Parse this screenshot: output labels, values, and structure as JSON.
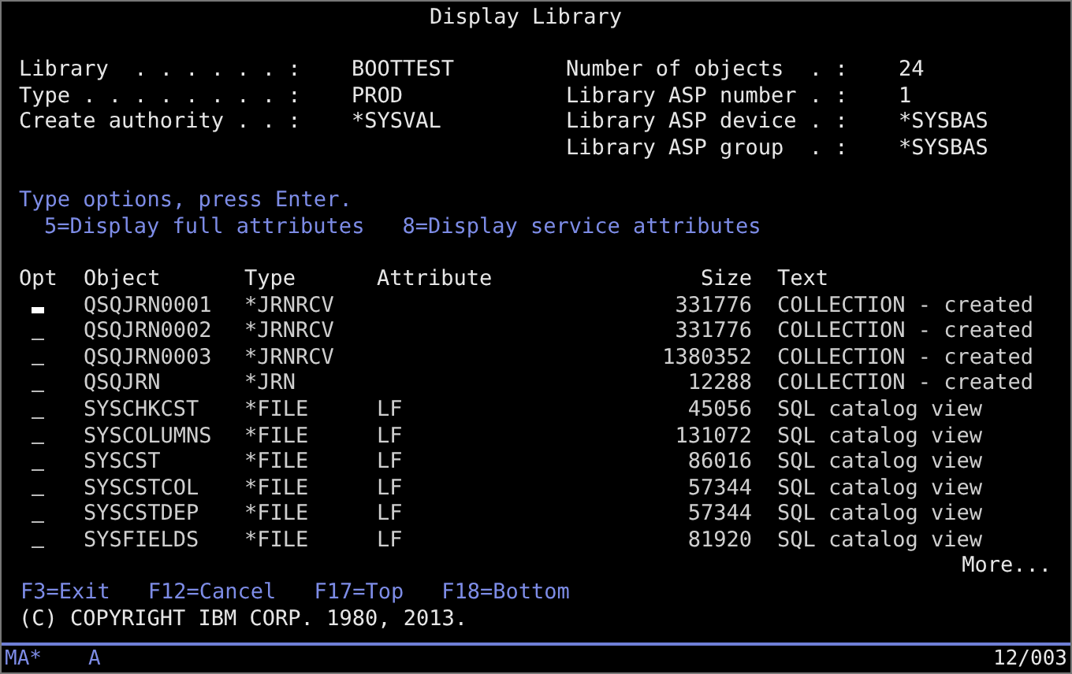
{
  "title": "Display Library",
  "header_left": [
    {
      "label": "Library  . . . . . . :",
      "value": "BOOTTEST"
    },
    {
      "label": "Type . . . . . . . . :",
      "value": "PROD"
    },
    {
      "label": "Create authority . . :",
      "value": "*SYSVAL"
    }
  ],
  "header_right": [
    {
      "label": "Number of objects  . :",
      "value": "24"
    },
    {
      "label": "Library ASP number . :",
      "value": "1"
    },
    {
      "label": "Library ASP device . :",
      "value": "*SYSBAS"
    },
    {
      "label": "Library ASP group  . :",
      "value": "*SYSBAS"
    }
  ],
  "instructions": "Type options, press Enter.",
  "options": [
    "5=Display full attributes",
    "8=Display service attributes"
  ],
  "table": {
    "columns": [
      "Opt",
      "Object",
      "Type",
      "Attribute",
      "Size",
      "Text"
    ],
    "rows": [
      {
        "object": "QSQJRN0001",
        "type": "*JRNRCV",
        "attribute": "",
        "size": "331776",
        "text": "COLLECTION - created",
        "focused": true
      },
      {
        "object": "QSQJRN0002",
        "type": "*JRNRCV",
        "attribute": "",
        "size": "331776",
        "text": "COLLECTION - created",
        "focused": false
      },
      {
        "object": "QSQJRN0003",
        "type": "*JRNRCV",
        "attribute": "",
        "size": "1380352",
        "text": "COLLECTION - created",
        "focused": false
      },
      {
        "object": "QSQJRN",
        "type": "*JRN",
        "attribute": "",
        "size": "12288",
        "text": "COLLECTION - created",
        "focused": false
      },
      {
        "object": "SYSCHKCST",
        "type": "*FILE",
        "attribute": "LF",
        "size": "45056",
        "text": "SQL catalog view",
        "focused": false
      },
      {
        "object": "SYSCOLUMNS",
        "type": "*FILE",
        "attribute": "LF",
        "size": "131072",
        "text": "SQL catalog view",
        "focused": false
      },
      {
        "object": "SYSCST",
        "type": "*FILE",
        "attribute": "LF",
        "size": "86016",
        "text": "SQL catalog view",
        "focused": false
      },
      {
        "object": "SYSCSTCOL",
        "type": "*FILE",
        "attribute": "LF",
        "size": "57344",
        "text": "SQL catalog view",
        "focused": false
      },
      {
        "object": "SYSCSTDEP",
        "type": "*FILE",
        "attribute": "LF",
        "size": "57344",
        "text": "SQL catalog view",
        "focused": false
      },
      {
        "object": "SYSFIELDS",
        "type": "*FILE",
        "attribute": "LF",
        "size": "81920",
        "text": "SQL catalog view",
        "focused": false
      }
    ]
  },
  "more": "More...",
  "function_keys": [
    "F3=Exit",
    "F12=Cancel",
    "F17=Top",
    "F18=Bottom"
  ],
  "message": "(C) COPYRIGHT IBM CORP. 1980, 2013.",
  "status_bar": {
    "mode": "MA*",
    "indicator": "A",
    "cursor_position": "12/003"
  }
}
